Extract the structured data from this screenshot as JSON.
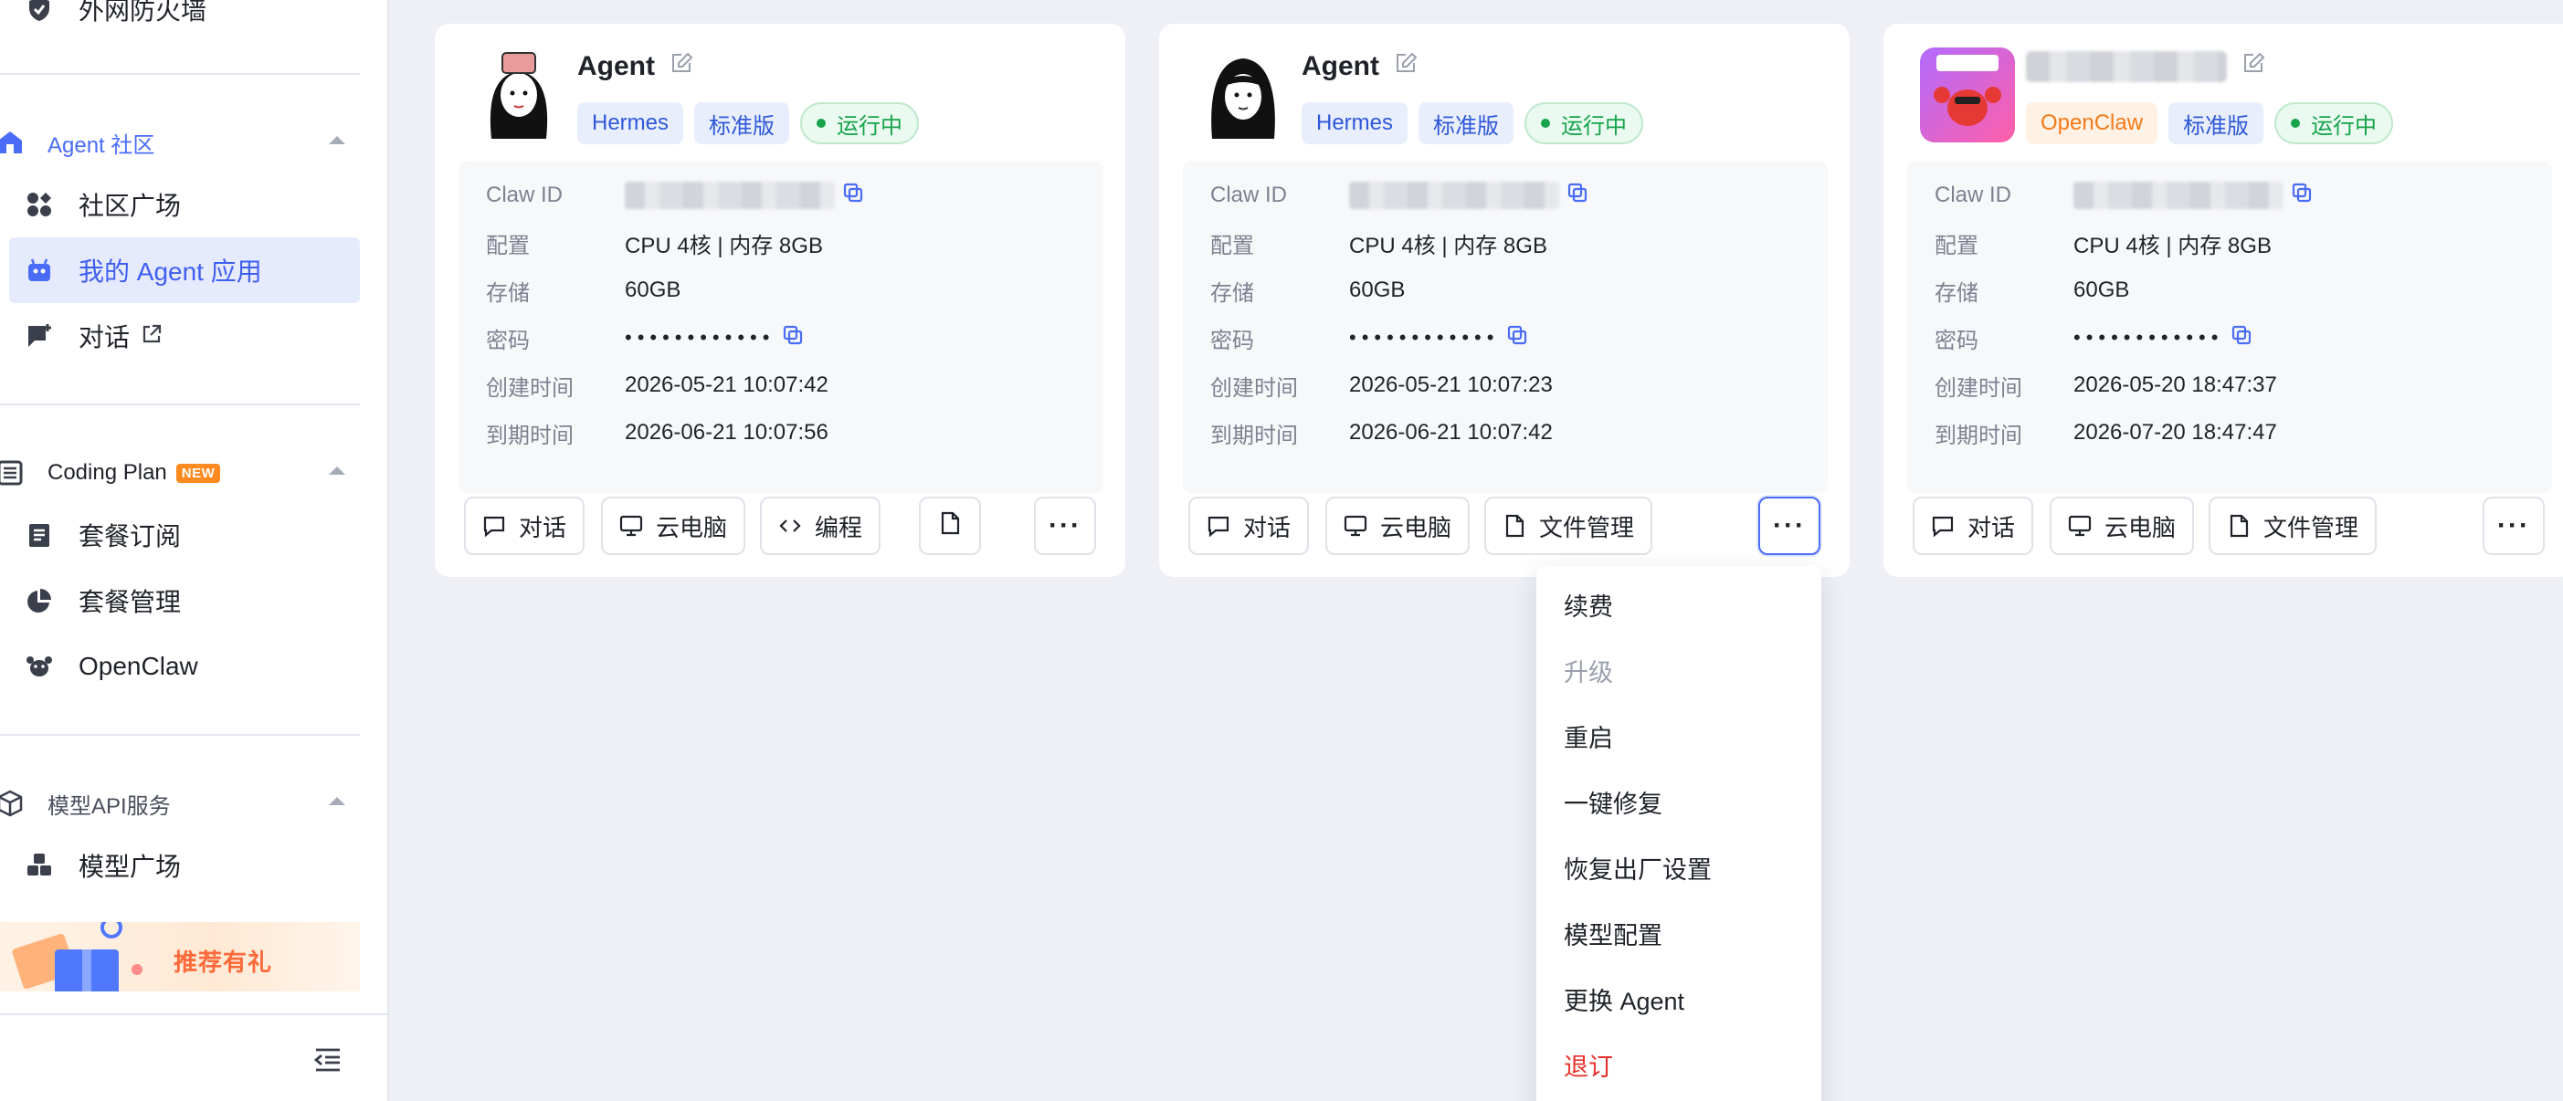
{
  "sidebar": {
    "top_item": {
      "label": "外网防火墙"
    },
    "sections": {
      "agent_community": {
        "label": "Agent 社区",
        "items": [
          "社区广场",
          "我的 Agent 应用",
          "对话"
        ]
      },
      "coding_plan": {
        "label": "Coding Plan",
        "badge": "NEW",
        "items": [
          "套餐订阅",
          "套餐管理",
          "OpenClaw"
        ]
      },
      "model_api": {
        "label": "模型API服务",
        "items": [
          "模型广场"
        ]
      }
    },
    "promo": {
      "label": "推荐有礼"
    },
    "accent": "#4a6cf7"
  },
  "cards": [
    {
      "name": "Agent",
      "tags": [
        "Hermes",
        "标准版"
      ],
      "status": "运行中",
      "labels": {
        "claw_id": "Claw ID",
        "config": "配置",
        "storage": "存储",
        "password": "密码",
        "created": "创建时间",
        "expires": "到期时间"
      },
      "config": "CPU 4核 | 内存 8GB",
      "storage": "60GB",
      "password": "••••••••••••",
      "created": "2026-05-21 10:07:42",
      "expires": "2026-06-21 10:07:56",
      "actions": {
        "chat": "对话",
        "cloud_pc": "云电脑",
        "code": "编程"
      }
    },
    {
      "name": "Agent",
      "tags": [
        "Hermes",
        "标准版"
      ],
      "status": "运行中",
      "labels": {
        "claw_id": "Claw ID",
        "config": "配置",
        "storage": "存储",
        "password": "密码",
        "created": "创建时间",
        "expires": "到期时间"
      },
      "config": "CPU 4核 | 内存 8GB",
      "storage": "60GB",
      "password": "••••••••••••",
      "created": "2026-05-21 10:07:23",
      "expires": "2026-06-21 10:07:42",
      "actions": {
        "chat": "对话",
        "cloud_pc": "云电脑",
        "files": "文件管理"
      }
    },
    {
      "name": "",
      "tags": [
        "OpenClaw",
        "标准版"
      ],
      "status": "运行中",
      "labels": {
        "claw_id": "Claw ID",
        "config": "配置",
        "storage": "存储",
        "password": "密码",
        "created": "创建时间",
        "expires": "到期时间"
      },
      "config": "CPU 4核 | 内存 8GB",
      "storage": "60GB",
      "password": "••••••••••••",
      "created": "2026-05-20 18:47:37",
      "expires": "2026-07-20 18:47:47",
      "actions": {
        "chat": "对话",
        "cloud_pc": "云电脑",
        "files": "文件管理"
      }
    }
  ],
  "more_menu": {
    "items": [
      "续费",
      "升级",
      "重启",
      "一键修复",
      "恢复出厂设置",
      "模型配置",
      "更换 Agent",
      "退订"
    ],
    "more_label": "···"
  },
  "colors": {
    "status_green": "#16a34a",
    "danger": "#e5322d",
    "tag_blue": "#2f58d8",
    "tag_orange": "#f07a1a"
  }
}
